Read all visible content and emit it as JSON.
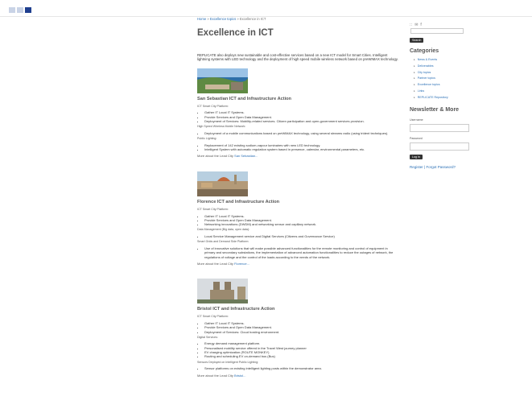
{
  "header": {
    "logo_alt": "Project logo"
  },
  "breadcrumb": {
    "home": "Home",
    "sep1": " » ",
    "topics": "Excellence topics",
    "sep2": " » ",
    "current": "Excellence in ICT"
  },
  "page": {
    "title": "Excellence in ICT",
    "intro": "REPLICATE also deploys new sustainable and cost-effective services based on a new ICT model for Smart Cities. Intelligent lightning systems with LED technology and the deployment of high speed mobile wireless network based on preWIMAX technology."
  },
  "sections": [
    {
      "title": "San Sebastian ICT and Infrastructure Action",
      "groups": [
        {
          "heading": "ICT Smart City Platform:",
          "items": [
            "Gather IT Local IT Systems.",
            "Provide Services and Open Data Management.",
            "Deployment of Services: Mobility-related services. Citizen participation and open-government services provision."
          ]
        },
        {
          "heading": "High Speed Wireless Mobile Network:",
          "items": [
            "Deployment of a mobile communications based on preWiMAX technology, using several streams radio (using trident techniques)."
          ]
        },
        {
          "heading": "Public Lighting:",
          "items": [
            "Replacement of 142 existing sodium-vapour luminaires with new LED technology.",
            "Intelligent System with automatic regulation system based in presence, calendar, environmental parameters, etc."
          ]
        }
      ],
      "more_text": "More about the Lead City ",
      "more_link": "San Sebastian..."
    },
    {
      "title": "Florence ICT and Infrastructure Action",
      "groups": [
        {
          "heading": "ICT Smart City Platform:",
          "items": [
            "Gather IT Local IT Systems.",
            "Provide Services and Open Data Management.",
            "Networking innovations (DWDM) and networking sensor and capillary network."
          ]
        },
        {
          "heading": "Data Management (Big data, open data):",
          "items": [
            "Local Service Management service and Digital Services (Citizens and Governance Service)"
          ]
        },
        {
          "heading": "Smart Grids and Demand Side Platform:",
          "items": [
            "Use of innovative solutions that will make possible advanced functionalities for the remote monitoring and control of equipment in primary and secondary substations, the implementation of advanced automation functionalities to reduce the outages of network, the regulations of voltage and the control of the loads according to the needs of the network."
          ]
        }
      ],
      "more_text": "More about the Lead City ",
      "more_link": "Florence..."
    },
    {
      "title": "Bristol ICT and Infrastructure Action",
      "groups": [
        {
          "heading": "ICT Smart City Platform:",
          "items": [
            "Gather IT Local IT Systems.",
            "Provide Services and Open Data Management.",
            "Deployment of Services: Cloud hosting environment."
          ]
        },
        {
          "heading": "Digital Services:",
          "items": [
            "Energy demand management platform.",
            "Personalised mobility service offered in the Travel West journey planner",
            "EV charging optimization (ROUTE MONKEY)",
            "Routing and scheduling EV on-demand bus (Bus)"
          ]
        },
        {
          "heading": "Sensors Deployed on Intelligent Public Lighting:",
          "items": [
            "Sensor platforms on existing intelligent lighting posts within the demonstrator area."
          ]
        }
      ],
      "more_text": "More about the Lead City ",
      "more_link": "Bristol..."
    }
  ],
  "sidebar": {
    "social": [
      "rss-icon",
      "mail-icon",
      "facebook-icon"
    ],
    "search_button": "Search",
    "categories_title": "Categories",
    "categories": [
      "News & Events",
      "Deliverables",
      "City topics",
      "Partner topics",
      "Excellence topics",
      "Links",
      "REPLICATE Repository"
    ],
    "newsletter_title": "Newsletter & More",
    "username_label": "Username",
    "password_label": "Password",
    "login_button": "Log in",
    "register": "Register",
    "divider": " | ",
    "forgot": "Forgot Password?"
  },
  "colors": {
    "link": "#2a6fb5",
    "heading": "#555555",
    "button": "#333333"
  }
}
